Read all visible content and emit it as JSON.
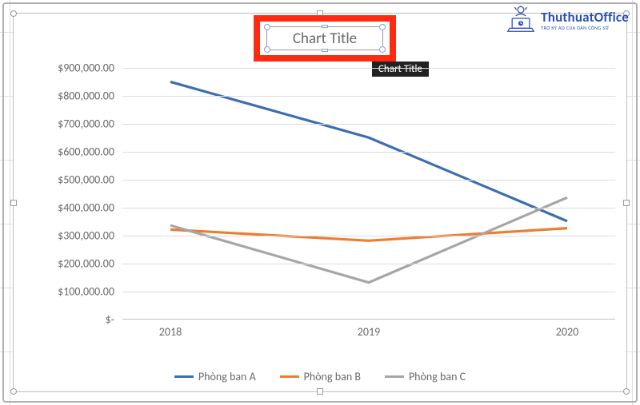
{
  "watermark": {
    "name": "ThuthuatOffice",
    "subtitle": "TRỢ KÝ ẢO CỦA DÂN CÔNG SỞ"
  },
  "chart_title_box": {
    "text": "Chart Title",
    "tooltip": "Chart Title"
  },
  "y_ticks": [
    "$-",
    "$100,000.00",
    "$200,000.00",
    "$300,000.00",
    "$400,000.00",
    "$500,000.00",
    "$600,000.00",
    "$700,000.00",
    "$800,000.00",
    "$900,000.00"
  ],
  "x_ticks": [
    "2018",
    "2019",
    "2020"
  ],
  "legend": [
    {
      "label": "Phòng ban A",
      "color": "#3c6db0"
    },
    {
      "label": "Phòng ban B",
      "color": "#ed7d31"
    },
    {
      "label": "Phòng ban C",
      "color": "#a6a6a6"
    }
  ],
  "chart_data": {
    "type": "line",
    "title": "Chart Title",
    "xlabel": "",
    "ylabel": "",
    "ylim": [
      0,
      900000
    ],
    "categories": [
      "2018",
      "2019",
      "2020"
    ],
    "series": [
      {
        "name": "Phòng ban A",
        "color": "#3c6db0",
        "values": [
          850000,
          650000,
          350000
        ]
      },
      {
        "name": "Phòng ban B",
        "color": "#ed7d31",
        "values": [
          320000,
          280000,
          325000
        ]
      },
      {
        "name": "Phòng ban C",
        "color": "#a6a6a6",
        "values": [
          335000,
          130000,
          435000
        ]
      }
    ],
    "y_tick_format": "currency",
    "grid": true,
    "legend_position": "bottom"
  }
}
